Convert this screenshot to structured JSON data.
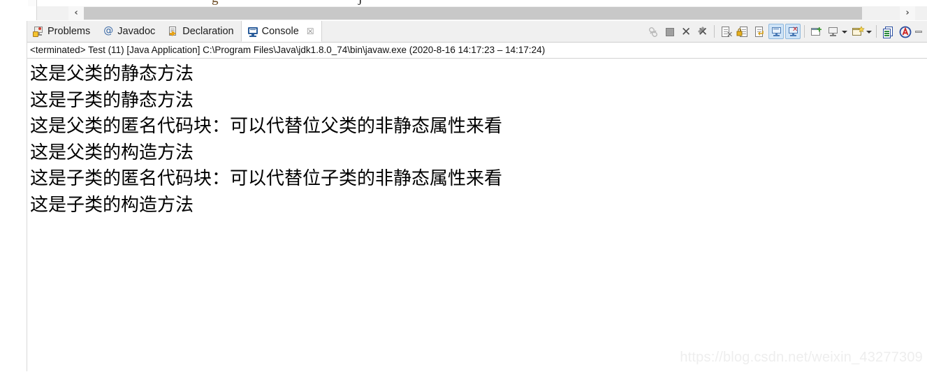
{
  "scrollbar": {
    "left_arrow": "‹",
    "right_arrow": "›"
  },
  "editor_remnant": {
    "glyph_left": "g",
    "glyph_right": "j"
  },
  "tabs": [
    {
      "label": "Problems",
      "icon": "problems-icon",
      "selected": false,
      "closable": false
    },
    {
      "label": "Javadoc",
      "icon": "javadoc-icon",
      "selected": false,
      "closable": false
    },
    {
      "label": "Declaration",
      "icon": "declaration-icon",
      "selected": false,
      "closable": false
    },
    {
      "label": "Console",
      "icon": "console-icon",
      "selected": true,
      "closable": true,
      "close_glyph": "☒"
    }
  ],
  "toolbar": {
    "items": [
      {
        "name": "pin-console-icon",
        "kind": "icon",
        "toggled": false
      },
      {
        "name": "stop-icon",
        "kind": "icon",
        "toggled": false
      },
      {
        "name": "remove-launch-icon",
        "kind": "icon",
        "toggled": false
      },
      {
        "name": "remove-all-launches-icon",
        "kind": "icon",
        "toggled": false
      },
      {
        "name": "separator-1",
        "kind": "sep"
      },
      {
        "name": "clear-console-icon",
        "kind": "icon",
        "toggled": false
      },
      {
        "name": "scroll-lock-icon",
        "kind": "icon",
        "toggled": false
      },
      {
        "name": "word-wrap-icon",
        "kind": "icon",
        "toggled": false
      },
      {
        "name": "show-console-on-output-icon",
        "kind": "icon",
        "toggled": true
      },
      {
        "name": "show-console-on-error-icon",
        "kind": "icon",
        "toggled": true
      },
      {
        "name": "separator-2",
        "kind": "sep"
      },
      {
        "name": "pin-console-window-icon",
        "kind": "icon",
        "toggled": false
      },
      {
        "name": "display-selected-console-icon",
        "kind": "icon",
        "toggled": false
      },
      {
        "name": "display-console-dropdown-arrow",
        "kind": "arrow"
      },
      {
        "name": "open-console-icon",
        "kind": "icon",
        "toggled": false
      },
      {
        "name": "open-console-dropdown-arrow",
        "kind": "arrow"
      },
      {
        "name": "separator-3",
        "kind": "sep"
      },
      {
        "name": "view-menu-icon",
        "kind": "icon",
        "toggled": false
      },
      {
        "name": "anyedit-icon",
        "kind": "icon",
        "toggled": false
      },
      {
        "name": "minimize-view-button",
        "kind": "min"
      }
    ]
  },
  "status": {
    "text": "<terminated> Test (11) [Java Application] C:\\Program Files\\Java\\jdk1.8.0_74\\bin\\javaw.exe  (2020-8-16 14:17:23 – 14:17:24)"
  },
  "console": {
    "lines": [
      "这是父类的静态方法",
      "这是子类的静态方法",
      "这是父类的匿名代码块：可以代替位父类的非静态属性来看",
      "这是父类的构造方法",
      "这是子类的匿名代码块：可以代替位子类的非静态属性来看",
      "这是子类的构造方法"
    ]
  },
  "watermark": {
    "text": "https://blog.csdn.net/weixin_43277309"
  },
  "colors": {
    "tab_selected_bg": "#ffffff",
    "tabbar_bg": "#f0f0f0",
    "toggle_highlight": "#cfe4f7",
    "scrollbar_thumb": "#c8c8c8",
    "console_text": "#000000",
    "watermark": "#eeeeee"
  }
}
